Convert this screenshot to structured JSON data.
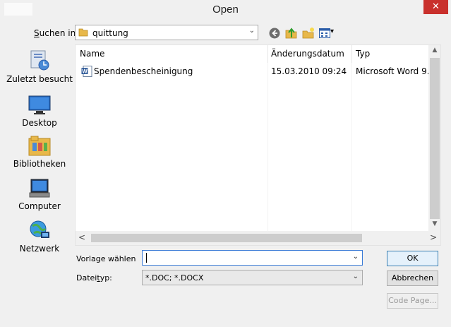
{
  "window": {
    "title": "Open",
    "close_glyph": "✕"
  },
  "lookin": {
    "label": "Suchen in:",
    "value": "quittung",
    "arrow_glyph": "⌄"
  },
  "toolbar": {
    "icons": [
      "back-icon",
      "up-folder-icon",
      "new-folder-icon",
      "views-menu-icon"
    ],
    "views_arrow": "▾"
  },
  "places": [
    {
      "label": "Zuletzt besucht",
      "icon": "recent-places-icon"
    },
    {
      "label": "Desktop",
      "icon": "desktop-icon"
    },
    {
      "label": "Bibliotheken",
      "icon": "libraries-icon"
    },
    {
      "label": "Computer",
      "icon": "computer-icon"
    },
    {
      "label": "Netzwerk",
      "icon": "network-icon"
    }
  ],
  "filelist": {
    "columns": [
      "Name",
      "Änderungsdatum",
      "Typ"
    ],
    "sort_glyph": "⌃",
    "rows": [
      {
        "name": "Spendenbescheinigung",
        "date": "15.03.2010 09:24",
        "type": "Microsoft Word 9...",
        "icon": "word-document-icon"
      }
    ],
    "scroll_up": "▲",
    "scroll_down": "▼",
    "scroll_left": "<",
    "scroll_right": ">"
  },
  "form": {
    "template_label": "Vorlage wählen",
    "template_value": "",
    "filetype_label": "Dateityp:",
    "filetype_value": "*.DOC; *.DOCX",
    "combo_arrow": "⌄"
  },
  "buttons": {
    "ok": "OK",
    "cancel": "Abbrechen",
    "code_page": "Code Page..."
  },
  "colors": {
    "accent": "#3b7bd6",
    "close": "#c9302c",
    "folder": "#e8b84a"
  }
}
